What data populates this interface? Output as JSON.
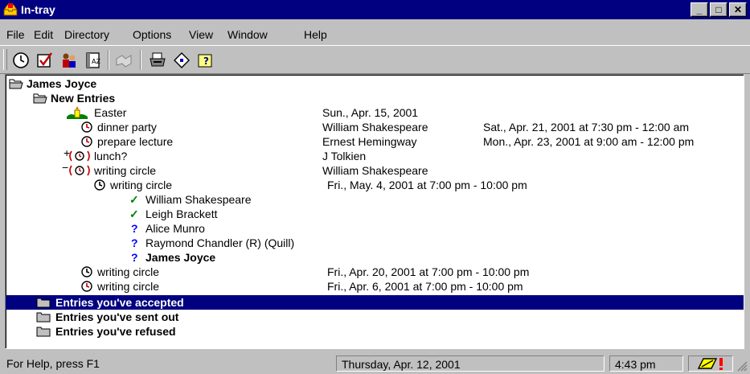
{
  "window": {
    "title": "In-tray"
  },
  "menu": [
    "File",
    "Edit",
    "Directory",
    "Options",
    "View",
    "Window",
    "Help"
  ],
  "toolbar": {
    "icons": [
      "clock-icon",
      "checkbox-icon",
      "people-icon",
      "address-book-icon",
      "handshake-icon",
      "printer-icon",
      "tag-icon",
      "help-icon"
    ]
  },
  "tree": {
    "root": "James Joyce",
    "folders": {
      "new_entries": "New Entries",
      "accepted": "Entries you've accepted",
      "sent_out": "Entries you've sent out",
      "refused": "Entries you've refused"
    },
    "items": [
      {
        "name": "Easter",
        "col2": "Sun., Apr. 15, 2001",
        "col3": ""
      },
      {
        "name": "dinner party",
        "col2": "William Shakespeare",
        "col3": "Sat., Apr. 21, 2001 at 7:30 pm - 12:00 am"
      },
      {
        "name": "prepare lecture",
        "col2": "Ernest Hemingway",
        "col3": "Mon., Apr. 23, 2001 at 9:00 am - 12:00 pm"
      },
      {
        "name": "lunch?",
        "col2": "J Tolkien",
        "col3": ""
      },
      {
        "name": "writing circle",
        "col2": "William Shakespeare",
        "col3": ""
      },
      {
        "name": "writing circle",
        "col2": "Fri., May. 4, 2001 at 7:00 pm - 10:00 pm",
        "col3": ""
      },
      {
        "name": "writing circle",
        "col2": "Fri., Apr. 20, 2001 at 7:00 pm - 10:00 pm",
        "col3": ""
      },
      {
        "name": "writing circle",
        "col2": "Fri., Apr. 6, 2001 at 7:00 pm - 10:00 pm",
        "col3": ""
      }
    ],
    "attendees": [
      {
        "name": "William Shakespeare",
        "status": "accepted"
      },
      {
        "name": "Leigh Brackett",
        "status": "accepted"
      },
      {
        "name": "Alice Munro",
        "status": "pending"
      },
      {
        "name": "Raymond Chandler (R) (Quill)",
        "status": "pending"
      },
      {
        "name": "James Joyce",
        "status": "pending"
      }
    ],
    "expand_plus": "+",
    "expand_minus": "−"
  },
  "status": {
    "help": "For Help, press F1",
    "date": "Thursday, Apr. 12, 2001",
    "time": "4:43 pm"
  },
  "colors": {
    "title_bar": "#000080",
    "selection": "#000080",
    "face": "#c0c0c0",
    "check": "#008000",
    "question": "#0000ff"
  }
}
